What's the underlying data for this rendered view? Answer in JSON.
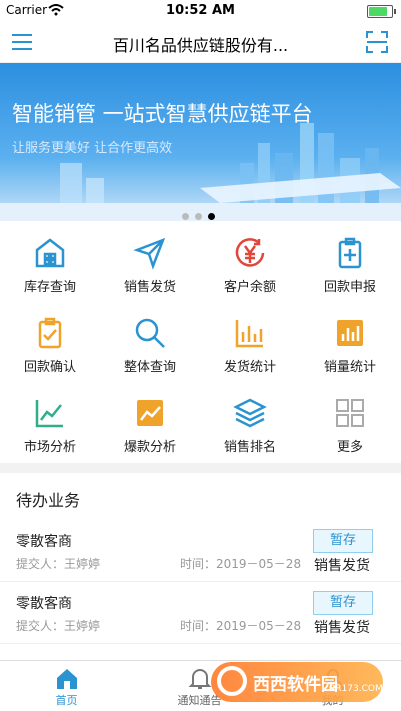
{
  "status": {
    "carrier": "Carrier",
    "time": "10:52 AM"
  },
  "navbar": {
    "title": "百川名品供应链股份有..."
  },
  "banner": {
    "headline": "智能销管  一站式智慧供应链平台",
    "tagline": "让服务更美好 让合作更高效",
    "slides": 3,
    "active_slide": 3
  },
  "grid": [
    {
      "label": "库存查询",
      "icon": "warehouse-icon",
      "color": "#2a93d0"
    },
    {
      "label": "销售发货",
      "icon": "paper-plane-icon",
      "color": "#2a93d0"
    },
    {
      "label": "客户余额",
      "icon": "yen-refresh-icon",
      "color": "#e0463a"
    },
    {
      "label": "回款申报",
      "icon": "clipboard-plus-icon",
      "color": "#2a93d0"
    },
    {
      "label": "回款确认",
      "icon": "clipboard-check-icon",
      "color": "#f0a32a"
    },
    {
      "label": "整体查询",
      "icon": "magnifier-icon",
      "color": "#2a93d0"
    },
    {
      "label": "发货统计",
      "icon": "bar-chart-icon",
      "color": "#f0a32a"
    },
    {
      "label": "销量统计",
      "icon": "bar-chart-box-icon",
      "color": "#f0a32a"
    },
    {
      "label": "市场分析",
      "icon": "line-chart-icon",
      "color": "#2fae8c"
    },
    {
      "label": "爆款分析",
      "icon": "trend-box-icon",
      "color": "#f0a32a"
    },
    {
      "label": "销售排名",
      "icon": "layers-icon",
      "color": "#2a93d0"
    },
    {
      "label": "更多",
      "icon": "more-grid-icon",
      "color": "#aaaaaa"
    }
  ],
  "pending": {
    "title": "待办业务",
    "items": [
      {
        "name": "零散客商",
        "submitter": "提交人：王婷婷",
        "time": "时间：2019－05－28",
        "status": "暂存",
        "type": "销售发货"
      },
      {
        "name": "零散客商",
        "submitter": "提交人：王婷婷",
        "time": "时间：2019－05－28",
        "status": "暂存",
        "type": "销售发货"
      }
    ]
  },
  "tabs": [
    {
      "label": "首页",
      "icon": "home-icon",
      "active": true
    },
    {
      "label": "通知通告",
      "icon": "bell-icon",
      "active": false
    },
    {
      "label": "我的",
      "icon": "user-icon",
      "active": false
    }
  ],
  "watermark": {
    "text": "西西软件园",
    "sub": "CR173.COM"
  },
  "colors": {
    "accent": "#2a93d0",
    "banner": "#2c8fe0"
  }
}
